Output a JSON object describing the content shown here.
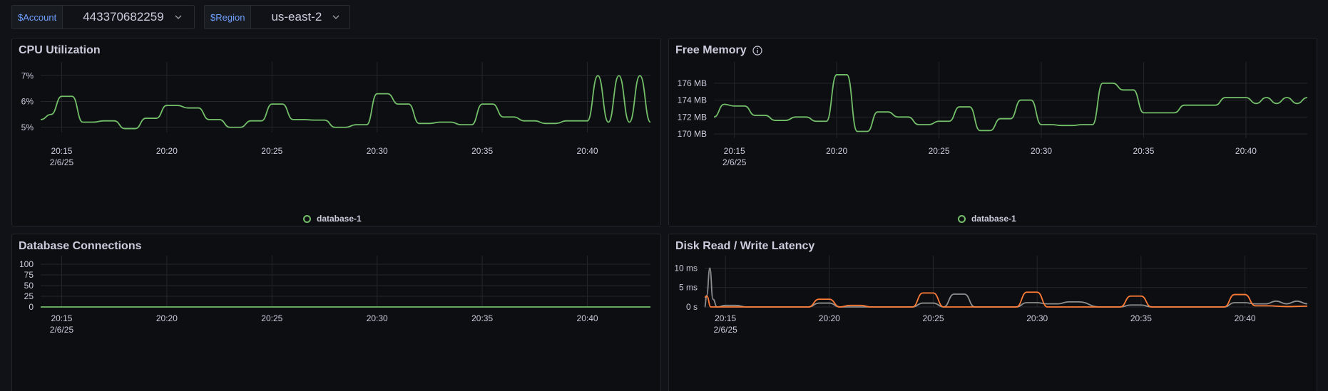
{
  "variables": [
    {
      "label": "$Account",
      "value": "443370682259"
    },
    {
      "label": "$Region",
      "value": "us-east-2"
    }
  ],
  "colors": {
    "green": "#73bf69",
    "orange": "#ff7c37",
    "gray": "#8e8e8e",
    "grid": "#24262c"
  },
  "panels": {
    "cpu": {
      "title": "CPU Utilization",
      "legend": "database-1"
    },
    "mem": {
      "title": "Free Memory",
      "legend": "database-1"
    },
    "conn": {
      "title": "Database Connections"
    },
    "disk": {
      "title": "Disk Read / Write Latency"
    }
  },
  "chart_data": [
    {
      "type": "line",
      "title": "CPU Utilization",
      "x_ticks": [
        "20:15",
        "20:20",
        "20:25",
        "20:30",
        "20:35",
        "20:40"
      ],
      "x_date_label": "2/6/25",
      "y_ticks": [
        "5%",
        "6%",
        "7%"
      ],
      "ylim": [
        4.8,
        7.2
      ],
      "xlim": [
        "20:14",
        "20:43"
      ],
      "legend": "bottom-center",
      "series": [
        {
          "name": "database-1",
          "color": "#73bf69",
          "x": [
            "20:14",
            "20:14.5",
            "20:15",
            "20:15.5",
            "20:16",
            "20:16.5",
            "20:17",
            "20:17.5",
            "20:18",
            "20:18.5",
            "20:19",
            "20:19.5",
            "20:20",
            "20:20.5",
            "20:21",
            "20:21.5",
            "20:22",
            "20:22.5",
            "20:23",
            "20:23.5",
            "20:24",
            "20:24.5",
            "20:25",
            "20:25.5",
            "20:26",
            "20:26.5",
            "20:27",
            "20:27.5",
            "20:28",
            "20:28.5",
            "20:29",
            "20:29.5",
            "20:30",
            "20:30.5",
            "20:31",
            "20:31.5",
            "20:32",
            "20:32.5",
            "20:33",
            "20:33.5",
            "20:34",
            "20:34.5",
            "20:35",
            "20:35.5",
            "20:36",
            "20:36.5",
            "20:37",
            "20:37.5",
            "20:38",
            "20:38.5",
            "20:39",
            "20:39.5",
            "20:40",
            "20:40.5",
            "20:41",
            "20:41.5",
            "20:42",
            "20:42.5",
            "20:43"
          ],
          "y": [
            5.3,
            5.5,
            6.2,
            6.2,
            5.2,
            5.2,
            5.25,
            5.25,
            4.95,
            4.95,
            5.35,
            5.35,
            5.85,
            5.85,
            5.75,
            5.75,
            5.3,
            5.3,
            5.0,
            5.0,
            5.25,
            5.25,
            5.9,
            5.9,
            5.3,
            5.3,
            5.28,
            5.28,
            5.0,
            5.0,
            5.1,
            5.1,
            6.3,
            6.3,
            5.9,
            5.9,
            5.15,
            5.15,
            5.2,
            5.2,
            5.1,
            5.1,
            5.9,
            5.9,
            5.4,
            5.4,
            5.25,
            5.25,
            5.15,
            5.15,
            5.25,
            5.25,
            5.25,
            7.0,
            5.2,
            7.0,
            5.2,
            7.0,
            5.2
          ]
        }
      ]
    },
    {
      "type": "line",
      "title": "Free Memory",
      "x_ticks": [
        "20:15",
        "20:20",
        "20:25",
        "20:30",
        "20:35",
        "20:40"
      ],
      "x_date_label": "2/6/25",
      "y_ticks": [
        "170 MB",
        "172 MB",
        "174 MB",
        "176 MB"
      ],
      "ylim": [
        169.5,
        177.5
      ],
      "xlim": [
        "20:14",
        "20:43"
      ],
      "legend": "bottom-center",
      "series": [
        {
          "name": "database-1",
          "color": "#73bf69",
          "x": [
            "20:14",
            "20:14.5",
            "20:15",
            "20:15.5",
            "20:16",
            "20:16.5",
            "20:17",
            "20:17.5",
            "20:18",
            "20:18.5",
            "20:19",
            "20:19.5",
            "20:20",
            "20:20.5",
            "20:21",
            "20:21.5",
            "20:22",
            "20:22.5",
            "20:23",
            "20:23.5",
            "20:24",
            "20:24.5",
            "20:25",
            "20:25.5",
            "20:26",
            "20:26.5",
            "20:27",
            "20:27.5",
            "20:28",
            "20:28.5",
            "20:29",
            "20:29.5",
            "20:30",
            "20:30.5",
            "20:31",
            "20:31.5",
            "20:32",
            "20:32.5",
            "20:33",
            "20:33.5",
            "20:34",
            "20:34.5",
            "20:35",
            "20:35.5",
            "20:36",
            "20:36.5",
            "20:37",
            "20:37.5",
            "20:38",
            "20:38.5",
            "20:39",
            "20:39.5",
            "20:40",
            "20:40.5",
            "20:41",
            "20:41.5",
            "20:42",
            "20:42.5",
            "20:43"
          ],
          "y": [
            172,
            173.5,
            173.3,
            173.3,
            172.2,
            172.2,
            171.6,
            171.6,
            172,
            172,
            171.5,
            171.5,
            177,
            177,
            170.3,
            170.3,
            172.6,
            172.6,
            172,
            172,
            171.1,
            171.1,
            171.5,
            171.5,
            173.2,
            173.2,
            170.4,
            170.4,
            171.8,
            171.8,
            174,
            174,
            171.1,
            171.1,
            171,
            171,
            171.1,
            171.1,
            176,
            176,
            175.2,
            175.2,
            172.5,
            172.5,
            172.5,
            172.5,
            173.4,
            173.4,
            173.4,
            173.4,
            174.3,
            174.3,
            174.3,
            173.6,
            174.3,
            173.6,
            174.3,
            173.6,
            174.3
          ]
        }
      ]
    },
    {
      "type": "line",
      "title": "Database Connections",
      "x_ticks": [
        "20:15",
        "20:20",
        "20:25",
        "20:30",
        "20:35",
        "20:40"
      ],
      "x_date_label": "2/6/25",
      "y_ticks": [
        "0",
        "25",
        "50",
        "75",
        "100"
      ],
      "ylim": [
        0,
        100
      ],
      "xlim": [
        "20:14",
        "20:43"
      ],
      "series": [
        {
          "color": "#73bf69",
          "x": [
            "20:14",
            "20:43"
          ],
          "y": [
            0,
            0
          ]
        }
      ]
    },
    {
      "type": "line",
      "title": "Disk Read / Write Latency",
      "x_ticks": [
        "20:15",
        "20:20",
        "20:25",
        "20:30",
        "20:35",
        "20:40"
      ],
      "x_date_label": "2/6/25",
      "y_ticks": [
        "0 s",
        "5 ms",
        "10 ms"
      ],
      "ylim": [
        0,
        11
      ],
      "xlim": [
        "20:14",
        "20:43"
      ],
      "series": [
        {
          "color": "#8e8e8e",
          "x": [
            "20:14",
            "20:14.1",
            "20:14.25",
            "20:14.4",
            "20:14.6",
            "20:15",
            "20:15.5",
            "20:16",
            "20:17",
            "20:18",
            "20:19",
            "20:19.5",
            "20:20",
            "20:20.5",
            "20:21",
            "20:22",
            "20:23",
            "20:24",
            "20:24.5",
            "20:25",
            "20:25.5",
            "20:26",
            "20:26.5",
            "20:27",
            "20:27.5",
            "20:28",
            "20:29",
            "20:29.5",
            "20:30",
            "20:30.5",
            "20:31",
            "20:31.5",
            "20:32",
            "20:33",
            "20:34",
            "20:34.5",
            "20:35",
            "20:35.5",
            "20:36",
            "20:37",
            "20:38",
            "20:39",
            "20:39.5",
            "20:40",
            "20:40.5",
            "20:41",
            "20:41.5",
            "20:42",
            "20:42.5",
            "20:43"
          ],
          "y": [
            0,
            3,
            10,
            2,
            0,
            0.4,
            0.4,
            0,
            0,
            0,
            0,
            1,
            1,
            0,
            0,
            0,
            0,
            0,
            1,
            1,
            0,
            3.3,
            3.3,
            0,
            0,
            0,
            0,
            1.1,
            1.1,
            0.8,
            0.8,
            1.3,
            1.3,
            0,
            0,
            0.5,
            0.5,
            0,
            0,
            0,
            0,
            0,
            1.1,
            1.1,
            0.8,
            0.8,
            1.5,
            0.8,
            1.5,
            0.8
          ]
        },
        {
          "color": "#ff7c37",
          "x": [
            "20:14",
            "20:14.1",
            "20:14.3",
            "20:15",
            "20:16",
            "20:17",
            "20:18",
            "20:19",
            "20:19.5",
            "20:20",
            "20:20.5",
            "20:21",
            "20:21.5",
            "20:22",
            "20:23",
            "20:24",
            "20:24.5",
            "20:25",
            "20:25.5",
            "20:26",
            "20:27",
            "20:28",
            "20:29",
            "20:29.5",
            "20:30",
            "20:30.5",
            "20:31",
            "20:32",
            "20:33",
            "20:34",
            "20:34.5",
            "20:35",
            "20:35.5",
            "20:36",
            "20:37",
            "20:38",
            "20:39",
            "20:39.5",
            "20:40",
            "20:40.5",
            "20:41",
            "20:42",
            "20:43"
          ],
          "y": [
            2.5,
            2.8,
            0,
            0,
            0,
            0,
            0,
            0,
            2,
            2,
            0,
            0.4,
            0.4,
            0,
            0,
            0,
            3.6,
            3.6,
            0,
            0,
            0,
            0,
            0,
            3.8,
            3.8,
            0,
            0,
            0,
            0,
            0,
            2.8,
            2.8,
            0,
            0,
            0,
            0,
            0,
            3.2,
            3.2,
            0.3,
            0.3,
            0.1,
            0.2
          ]
        }
      ]
    }
  ]
}
